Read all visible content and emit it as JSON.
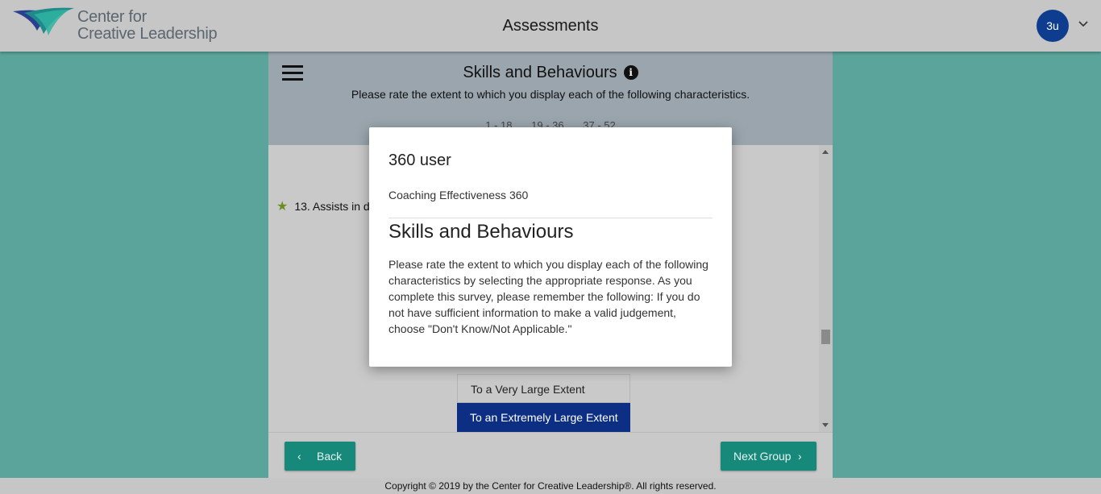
{
  "header": {
    "logo_line1": "Center for",
    "logo_line2": "Creative Leadership",
    "title": "Assessments",
    "avatar_initials": "3u"
  },
  "section": {
    "title": "Skills and Behaviours",
    "subtitle": "Please rate the extent to which you display each of the following characteristics.",
    "range_tabs": [
      "1 - 18",
      "19 - 36",
      "37 - 52"
    ]
  },
  "question": {
    "text": "13. Assists in d"
  },
  "options": {
    "very_large": "To a Very Large Extent",
    "extremely_large": "To an Extremely Large Extent"
  },
  "nav": {
    "back_label": "Back",
    "next_label": "Next Group"
  },
  "footer": {
    "copyright": "Copyright © 2019 by the Center for Creative Leadership®. All rights reserved."
  },
  "modal": {
    "user": "360 user",
    "survey": "Coaching Effectiveness 360",
    "title": "Skills and Behaviours",
    "body": "Please rate the extent to which you display each of the following characteristics by selecting the appropriate response. As you complete this survey, please remember the following: If you do not have sufficient information to make a valid judgement, choose \"Don't Know/Not Applicable.\""
  },
  "colors": {
    "background_teal": "#5ba49b",
    "avatar_blue": "#0e3d8f",
    "selected_option": "#0c2f83",
    "button_teal": "#16897a"
  }
}
